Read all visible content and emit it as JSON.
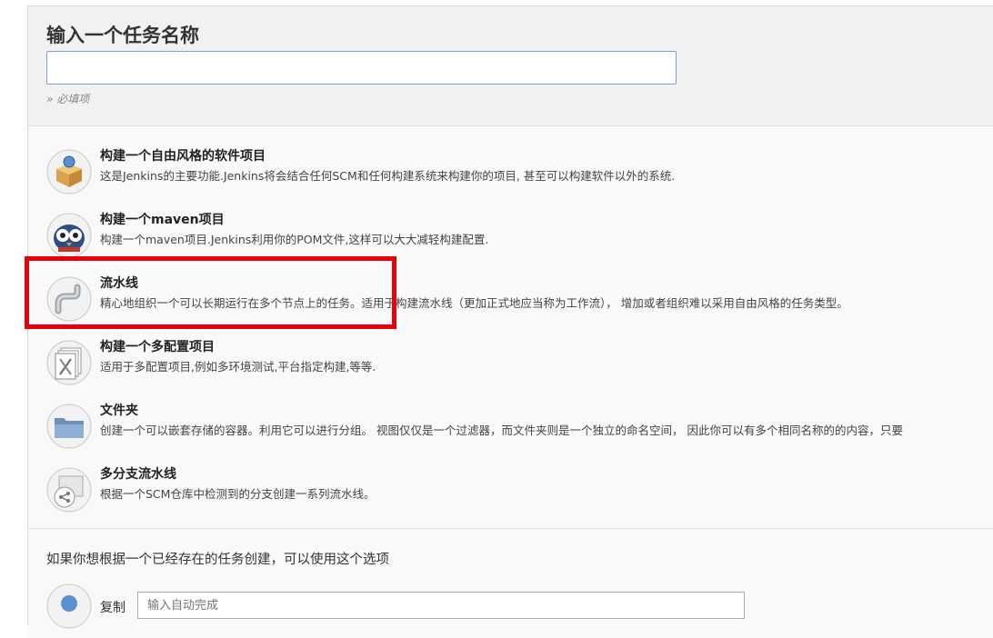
{
  "form": {
    "title": "输入一个任务名称",
    "name_value": "",
    "required_note": "» 必填项"
  },
  "items": [
    {
      "label": "构建一个自由风格的软件项目",
      "desc": "这是Jenkins的主要功能.Jenkins将会结合任何SCM和任何构建系统来构建你的项目, 甚至可以构建软件以外的系统.",
      "icon": "freestyle-box-icon"
    },
    {
      "label": "构建一个maven项目",
      "desc": "构建一个maven项目.Jenkins利用你的POM文件,这样可以大大减轻构建配置.",
      "icon": "maven-owl-icon"
    },
    {
      "label": "流水线",
      "desc": "精心地组织一个可以长期运行在多个节点上的任务。适用于构建流水线（更加正式地应当称为工作流）， 增加或者组织难以采用自由风格的任务类型。",
      "icon": "pipeline-icon"
    },
    {
      "label": "构建一个多配置项目",
      "desc": "适用于多配置项目,例如多环境测试,平台指定构建,等等.",
      "icon": "multiconfig-icon"
    },
    {
      "label": "文件夹",
      "desc": "创建一个可以嵌套存储的容器。利用它可以进行分组。 视图仅仅是一个过滤器，而文件夹则是一个独立的命名空间， 因此你可以有多个相同名称的的内容，只要",
      "icon": "folder-icon"
    },
    {
      "label": "多分支流水线",
      "desc": "根据一个SCM仓库中检测到的分支创建一系列流水线。",
      "icon": "multibranch-icon"
    }
  ],
  "copy": {
    "hint": "如果你想根据一个已经存在的任务创建，可以使用这个选项",
    "label": "复制",
    "placeholder": "输入自动完成"
  },
  "colors": {
    "highlight": "#e8000b",
    "input_border": "#7ba0cd"
  }
}
